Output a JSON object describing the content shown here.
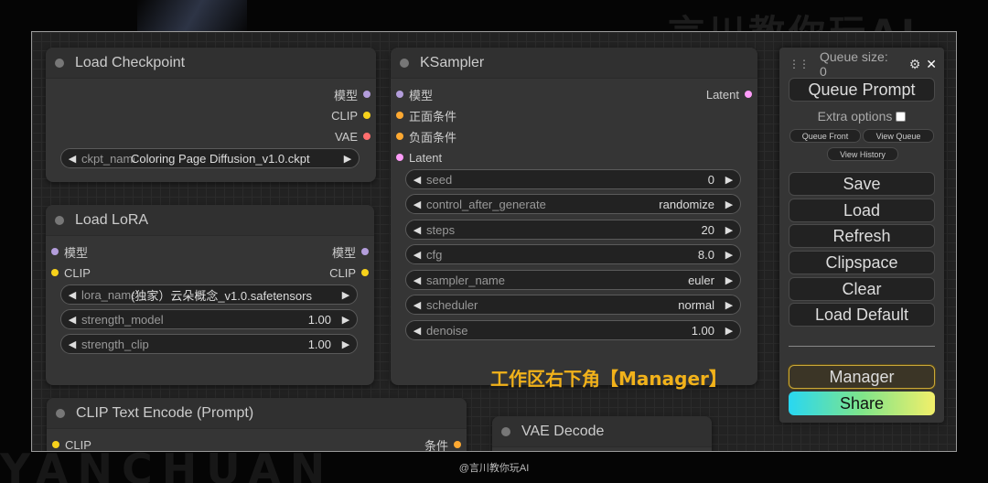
{
  "watermark_top": "言川教你玩AI",
  "watermark_bottom": "YANCHUAN",
  "footer_credit": "@言川教你玩AI",
  "annotation": "工作区右下角【Manager】",
  "colors": {
    "model_slot": "#b39ddb",
    "clip_slot": "#f7d21b",
    "vae_slot": "#ff6e6e",
    "positive_slot": "#ffa931",
    "latent_slot": "#ff9cf9",
    "conditioning_slot": "#ffa931",
    "annotation": "#f2b21a",
    "manager_border": "#c9a83a"
  },
  "nodes": {
    "load_checkpoint": {
      "title": "Load Checkpoint",
      "outputs": [
        "模型",
        "CLIP",
        "VAE"
      ],
      "ckpt_label": "ckpt_name",
      "ckpt_value": "Coloring Page Diffusion_v1.0.ckpt"
    },
    "load_lora": {
      "title": "Load LoRA",
      "inputs": [
        "模型",
        "CLIP"
      ],
      "outputs": [
        "模型",
        "CLIP"
      ],
      "widgets": [
        {
          "label": "lora_name",
          "value": "(独家）云朵概念_v1.0.safetensors"
        },
        {
          "label": "strength_model",
          "value": "1.00"
        },
        {
          "label": "strength_clip",
          "value": "1.00"
        }
      ]
    },
    "ksampler": {
      "title": "KSampler",
      "inputs": [
        "模型",
        "正面条件",
        "负面条件",
        "Latent"
      ],
      "outputs": [
        "Latent"
      ],
      "widgets": [
        {
          "label": "seed",
          "value": "0"
        },
        {
          "label": "control_after_generate",
          "value": "randomize"
        },
        {
          "label": "steps",
          "value": "20"
        },
        {
          "label": "cfg",
          "value": "8.0"
        },
        {
          "label": "sampler_name",
          "value": "euler"
        },
        {
          "label": "scheduler",
          "value": "normal"
        },
        {
          "label": "denoise",
          "value": "1.00"
        }
      ]
    },
    "clip_text_encode": {
      "title": "CLIP Text Encode (Prompt)",
      "inputs": [
        "CLIP"
      ],
      "outputs": [
        "条件"
      ]
    },
    "vae_decode": {
      "title": "VAE Decode"
    }
  },
  "menu": {
    "queue_size": "Queue size: 0",
    "queue_prompt": "Queue Prompt",
    "extra_options": "Extra options",
    "queue_front": "Queue Front",
    "view_queue": "View Queue",
    "view_history": "View History",
    "save": "Save",
    "load": "Load",
    "refresh": "Refresh",
    "clipspace": "Clipspace",
    "clear": "Clear",
    "load_default": "Load Default",
    "manager": "Manager",
    "share": "Share"
  }
}
